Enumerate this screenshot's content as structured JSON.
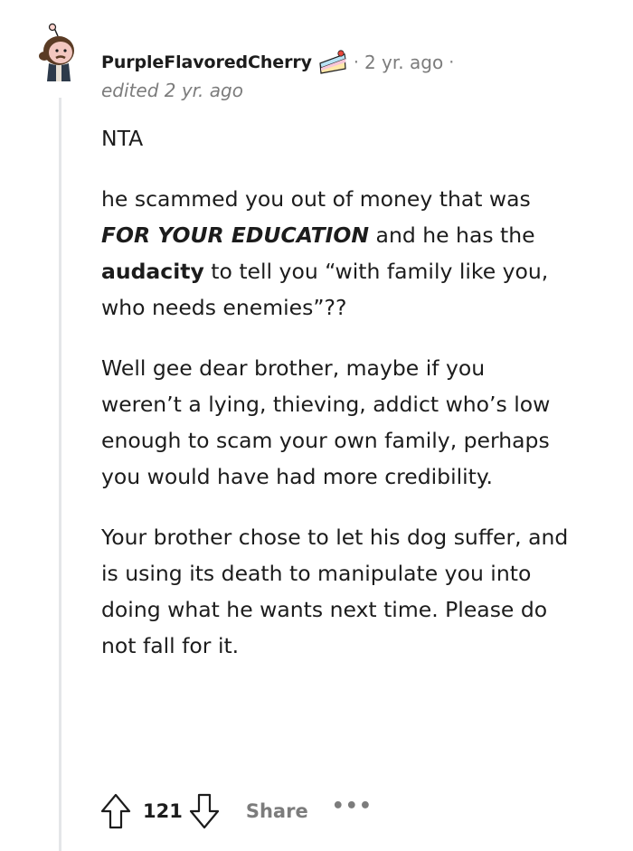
{
  "comment": {
    "username": "PurpleFlavoredCherry",
    "flair_icon": "cake-icon",
    "separator": "·",
    "age": "2 yr. ago",
    "edited": "edited 2 yr. ago",
    "body": {
      "p1": "NTA",
      "p2": {
        "a": "he scammed you out of money that was ",
        "b": "FOR YOUR EDUCATION",
        "c": " and he has the ",
        "d": "audacity",
        "e": " to tell you “with family like you, who needs enemies”??"
      },
      "p3": "Well gee dear brother, maybe if you weren’t a lying, thieving, addict who’s low enough to scam your own family, perhaps you would have had more credibility.",
      "p4": "Your brother chose to let his dog suffer, and is using its death to manipulate you into doing what he wants next time. Please do not fall for it."
    },
    "actions": {
      "upvote_icon": "upvote-arrow-icon",
      "score": "121",
      "downvote_icon": "downvote-arrow-icon",
      "share_label": "Share",
      "more": "•••"
    }
  }
}
